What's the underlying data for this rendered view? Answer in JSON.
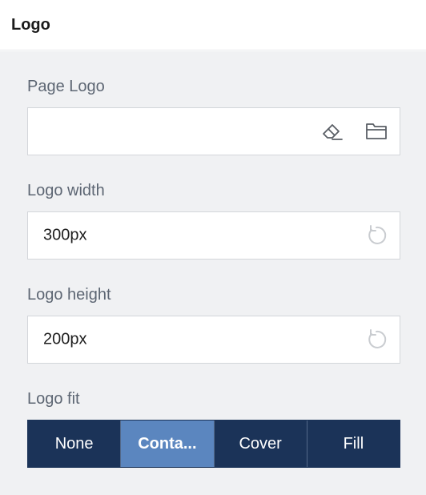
{
  "header": {
    "title": "Logo"
  },
  "page_logo": {
    "label": "Page Logo",
    "value": "",
    "icons": {
      "clear": "eraser-icon",
      "browse": "folder-open-icon"
    }
  },
  "logo_width": {
    "label": "Logo width",
    "value": "300px",
    "icons": {
      "reset": "reset-icon"
    }
  },
  "logo_height": {
    "label": "Logo height",
    "value": "200px",
    "icons": {
      "reset": "reset-icon"
    }
  },
  "logo_fit": {
    "label": "Logo fit",
    "options": [
      "None",
      "Conta...",
      "Cover",
      "Fill"
    ],
    "selected": "Conta..."
  },
  "colors": {
    "header_bg": "#ffffff",
    "panel_bg": "#f0f1f3",
    "label": "#5d6673",
    "segment_bg": "#1b3358",
    "segment_active": "#5b86bf"
  }
}
